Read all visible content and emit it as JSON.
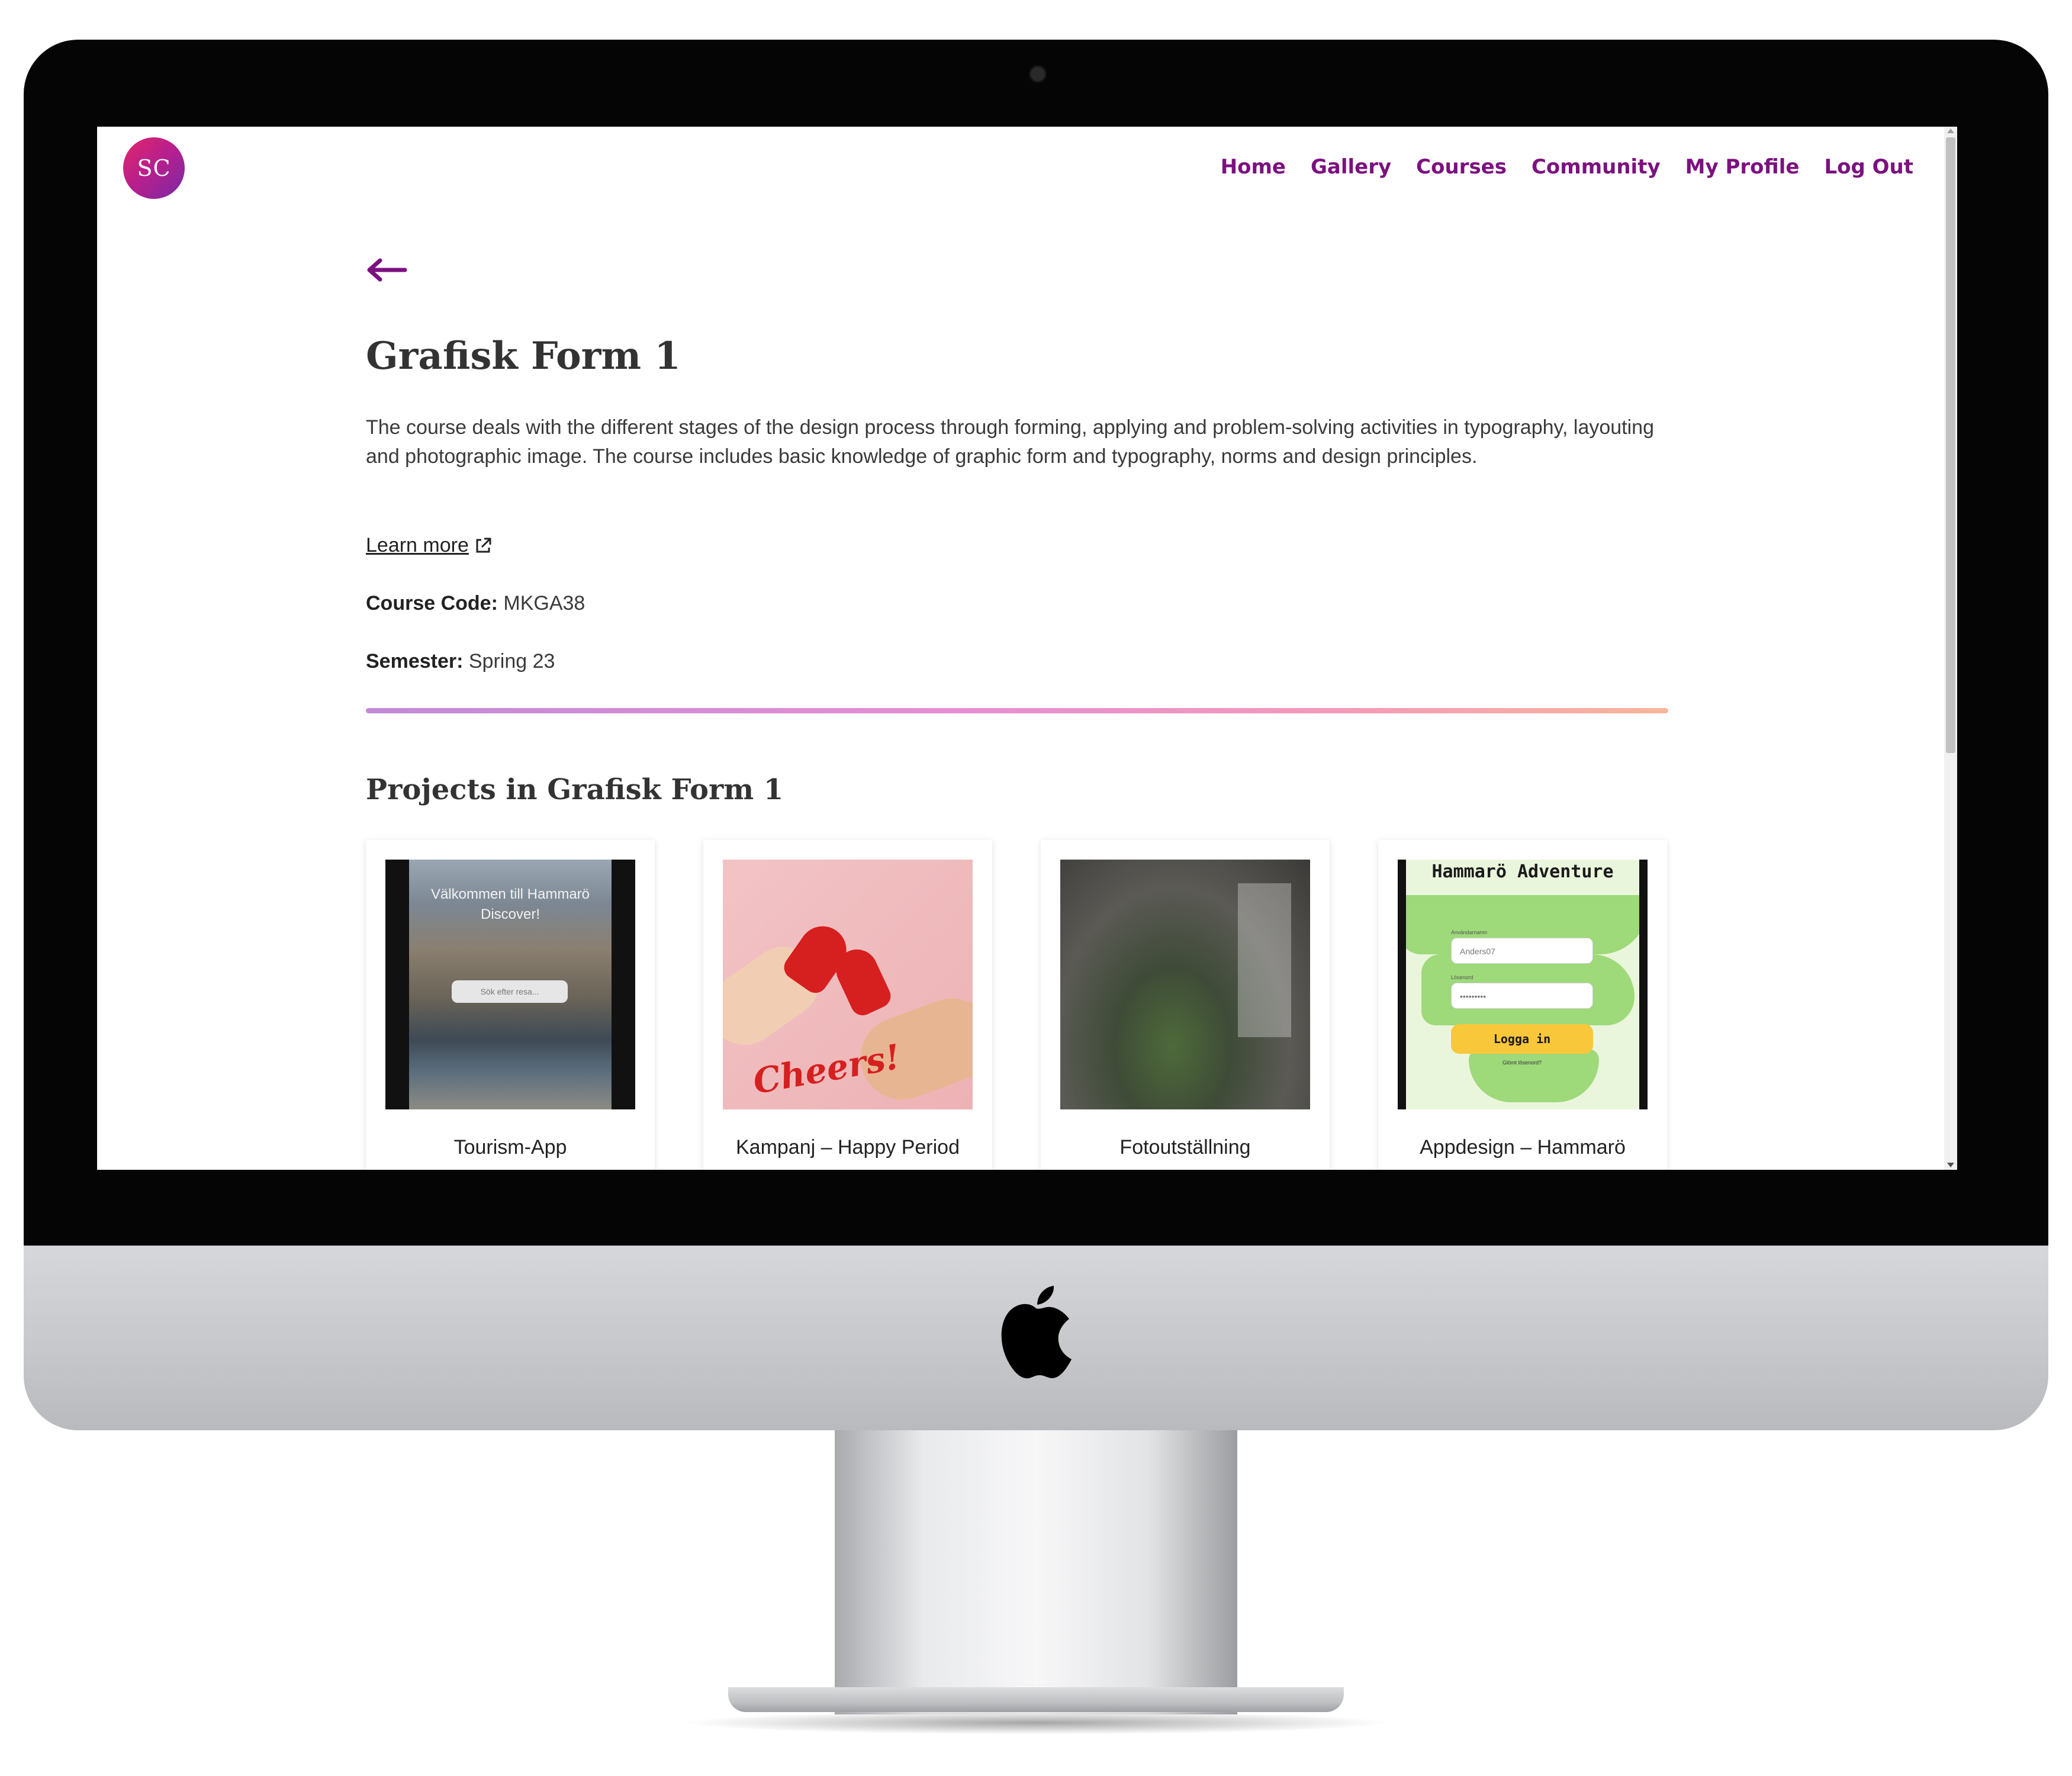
{
  "nav": {
    "logo_text": "SC",
    "items": [
      "Home",
      "Gallery",
      "Courses",
      "Community",
      "My Profile",
      "Log Out"
    ]
  },
  "course": {
    "title": "Grafisk Form 1",
    "description": "The course deals with the different stages of the design process through forming, applying and problem-solving activities in typography, layouting and photographic image. The course includes basic knowledge of graphic form and typography, norms and design principles.",
    "learn_more": "Learn more",
    "code_label": "Course Code:",
    "code_value": "MKGA38",
    "semester_label": "Semester:",
    "semester_value": "Spring 23"
  },
  "projects": {
    "heading": "Projects in Grafisk Form 1",
    "items": [
      {
        "label": "Tourism-App",
        "thumb_text": "Välkommen till Hammarö Discover!",
        "thumb_search": "Sök efter resa..."
      },
      {
        "label": "Kampanj – Happy Period",
        "thumb_text": "Cheers!"
      },
      {
        "label": "Fotoutställning"
      },
      {
        "label": "Appdesign – Hammarö",
        "thumb_title": "Hammarö Adventure",
        "thumb_user_label": "Användarnamn",
        "thumb_user": "Anders07",
        "thumb_pass_label": "Lösenord",
        "thumb_pass": "•••••••••",
        "thumb_button": "Logga in",
        "thumb_forgot": "Glömt lösenord?"
      }
    ]
  },
  "colors": {
    "accent": "#7c1180",
    "text": "#333333",
    "divider_gradient": [
      "#c28ad8",
      "#e58ed4",
      "#f49ab8",
      "#f7b69b"
    ]
  },
  "icons": {
    "back": "arrow-left-icon",
    "external": "external-link-icon",
    "device_logo": "apple-logo-icon"
  }
}
